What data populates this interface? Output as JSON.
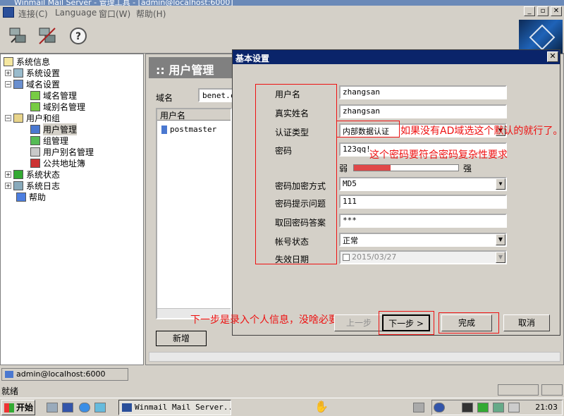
{
  "app": {
    "title": "Winmail Mail Server - 管理工具 - [admin@localhost:6000]"
  },
  "menu": {
    "items": [
      "连接(C)",
      "Language",
      "窗口(W)",
      "帮助(H)"
    ]
  },
  "tree": {
    "items": [
      {
        "label": "系统信息"
      },
      {
        "label": "系统设置"
      },
      {
        "label": "域名设置"
      },
      {
        "label": "域名管理"
      },
      {
        "label": "域别名管理"
      },
      {
        "label": "用户和组"
      },
      {
        "label": "用户管理"
      },
      {
        "label": "组管理"
      },
      {
        "label": "用户别名管理"
      },
      {
        "label": "公共地址簿"
      },
      {
        "label": "系统状态"
      },
      {
        "label": "系统日志"
      },
      {
        "label": "帮助"
      }
    ]
  },
  "panel": {
    "title": ":: 用户管理",
    "domain_label": "域名",
    "domain_value": "benet.c",
    "list_header": "用户名",
    "users": [
      "postmaster"
    ],
    "add_button": "新增"
  },
  "dialog": {
    "title": "基本设置",
    "labels": {
      "username": "用户名",
      "realname": "真实姓名",
      "auth": "认证类型",
      "password": "密码",
      "encrypt": "密码加密方式",
      "hint": "密码提示问题",
      "answer": "取回密码答案",
      "status": "帐号状态",
      "expire": "失效日期"
    },
    "values": {
      "username": "zhangsan",
      "realname": "zhangsan",
      "auth": "内部数据认证",
      "password": "123qq!",
      "encrypt": "MD5",
      "hint": "111",
      "answer": "***",
      "status": "正常",
      "expire": "2015/03/27"
    },
    "strength": {
      "weak": "弱",
      "strong": "强",
      "level": 0.35
    },
    "buttons": {
      "prev": "上一步",
      "next": "下一步 >",
      "finish": "完成",
      "cancel": "取消"
    }
  },
  "annotations": {
    "auth_note": "如果没有AD域选这个默认的就行了。",
    "password_note": "这个密码要符合密码复杂性要求",
    "next_note": "下一步是录入个人信息，没啥必要"
  },
  "status": {
    "connection": "admin@localhost:6000",
    "ready": "就绪"
  },
  "taskbar": {
    "start": "开始",
    "task": "Winmail Mail Server...",
    "clock": "21:03"
  }
}
